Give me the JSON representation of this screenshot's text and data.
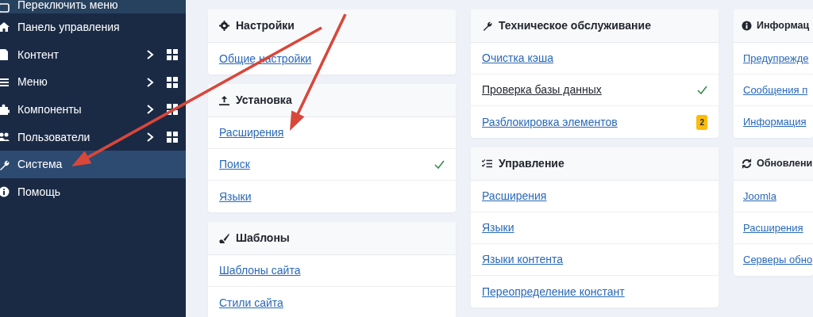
{
  "sidebar": {
    "items": [
      {
        "label": "Переключить меню",
        "selected": false,
        "submenu": false
      },
      {
        "label": "Панель управления",
        "selected": false,
        "submenu": false
      },
      {
        "label": "Контент",
        "selected": false,
        "submenu": true
      },
      {
        "label": "Меню",
        "selected": false,
        "submenu": true
      },
      {
        "label": "Компоненты",
        "selected": false,
        "submenu": true
      },
      {
        "label": "Пользователи",
        "selected": false,
        "submenu": true
      },
      {
        "label": "Система",
        "selected": true,
        "submenu": false
      },
      {
        "label": "Помощь",
        "selected": false,
        "submenu": false
      }
    ]
  },
  "columns": [
    [
      {
        "title": "Настройки",
        "items": [
          {
            "label": "Общие настройки",
            "kind": "link",
            "checked": false
          }
        ]
      },
      {
        "title": "Установка",
        "items": [
          {
            "label": "Расширения",
            "kind": "link",
            "checked": false
          },
          {
            "label": "Поиск",
            "kind": "link",
            "checked": true
          },
          {
            "label": "Языки",
            "kind": "link",
            "checked": false
          }
        ]
      },
      {
        "title": "Шаблоны",
        "items": [
          {
            "label": "Шаблоны сайта",
            "kind": "link",
            "checked": false
          },
          {
            "label": "Стили сайта",
            "kind": "link",
            "checked": false
          }
        ]
      }
    ],
    [
      {
        "title": "Техническое обслуживание",
        "items": [
          {
            "label": "Очистка кэша",
            "kind": "link",
            "checked": false
          },
          {
            "label": "Проверка базы данных",
            "kind": "plain",
            "checked": true
          },
          {
            "label": "Разблокировка элементов",
            "kind": "link",
            "checked": false,
            "badge": "2"
          }
        ]
      },
      {
        "title": "Управление",
        "items": [
          {
            "label": "Расширения",
            "kind": "link",
            "checked": false
          },
          {
            "label": "Языки",
            "kind": "link",
            "checked": false
          },
          {
            "label": "Языки контента",
            "kind": "link",
            "checked": false
          },
          {
            "label": "Переопределение констант",
            "kind": "link",
            "checked": false
          }
        ]
      }
    ],
    [
      {
        "title": "Информац",
        "items": [
          {
            "label": "Предупрежде",
            "kind": "link",
            "checked": false
          },
          {
            "label": "Сообщения п",
            "kind": "link",
            "checked": false
          },
          {
            "label": "Информация",
            "kind": "link",
            "checked": false
          }
        ]
      },
      {
        "title": "Обновлени",
        "items": [
          {
            "label": "Joomla",
            "kind": "link",
            "checked": false
          },
          {
            "label": "Расширения",
            "kind": "link",
            "checked": false
          },
          {
            "label": "Серверы обно",
            "kind": "link",
            "checked": false
          }
        ]
      }
    ]
  ],
  "annotations": [
    {
      "kind": "arrow"
    },
    {
      "kind": "arrow"
    }
  ]
}
